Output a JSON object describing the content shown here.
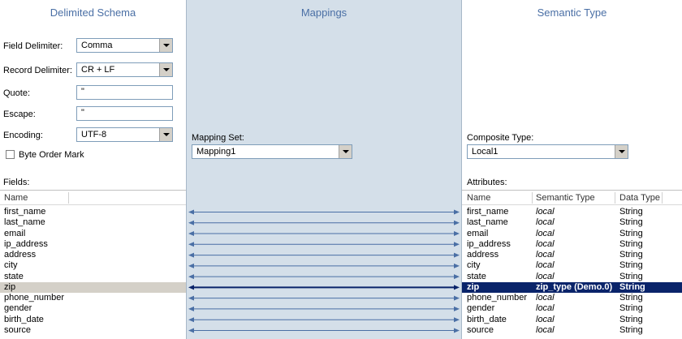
{
  "left": {
    "title": "Delimited Schema",
    "field_delimiter_label": "Field Delimiter:",
    "field_delimiter_value": "Comma",
    "record_delimiter_label": "Record Delimiter:",
    "record_delimiter_value": "CR + LF",
    "quote_label": "Quote:",
    "quote_value": "\"",
    "escape_label": "Escape:",
    "escape_value": "\"",
    "encoding_label": "Encoding:",
    "encoding_value": "UTF-8",
    "bom_label": "Byte Order Mark",
    "fields_label": "Fields:",
    "col_name": "Name",
    "fields": [
      "first_name",
      "last_name",
      "email",
      "ip_address",
      "address",
      "city",
      "state",
      "zip",
      "phone_number",
      "gender",
      "birth_date",
      "source"
    ]
  },
  "middle": {
    "title": "Mappings",
    "mapping_set_label": "Mapping Set:",
    "mapping_set_value": "Mapping1"
  },
  "right": {
    "title": "Semantic Type",
    "composite_type_label": "Composite Type:",
    "composite_type_value": "Local1",
    "attributes_label": "Attributes:",
    "col_name": "Name",
    "col_semantic": "Semantic Type",
    "col_datatype": "Data Type",
    "attributes": [
      {
        "name": "first_name",
        "semantic": "local",
        "type": "String"
      },
      {
        "name": "last_name",
        "semantic": "local",
        "type": "String"
      },
      {
        "name": "email",
        "semantic": "local",
        "type": "String"
      },
      {
        "name": "ip_address",
        "semantic": "local",
        "type": "String"
      },
      {
        "name": "address",
        "semantic": "local",
        "type": "String"
      },
      {
        "name": "city",
        "semantic": "local",
        "type": "String"
      },
      {
        "name": "state",
        "semantic": "local",
        "type": "String"
      },
      {
        "name": "zip",
        "semantic": "zip_type (Demo.0)",
        "type": "String"
      },
      {
        "name": "phone_number",
        "semantic": "local",
        "type": "String"
      },
      {
        "name": "gender",
        "semantic": "local",
        "type": "String"
      },
      {
        "name": "birth_date",
        "semantic": "local",
        "type": "String"
      },
      {
        "name": "source",
        "semantic": "local",
        "type": "String"
      }
    ]
  },
  "selected_index": 7,
  "colors": {
    "accent_title": "#4a6fa5",
    "mapping_bg": "#d4dfe9",
    "selected_right_bg": "#0a246a",
    "selected_left_bg": "#d4d0c8",
    "arrow": "#4a6fa5",
    "arrow_selected": "#0a246a"
  }
}
